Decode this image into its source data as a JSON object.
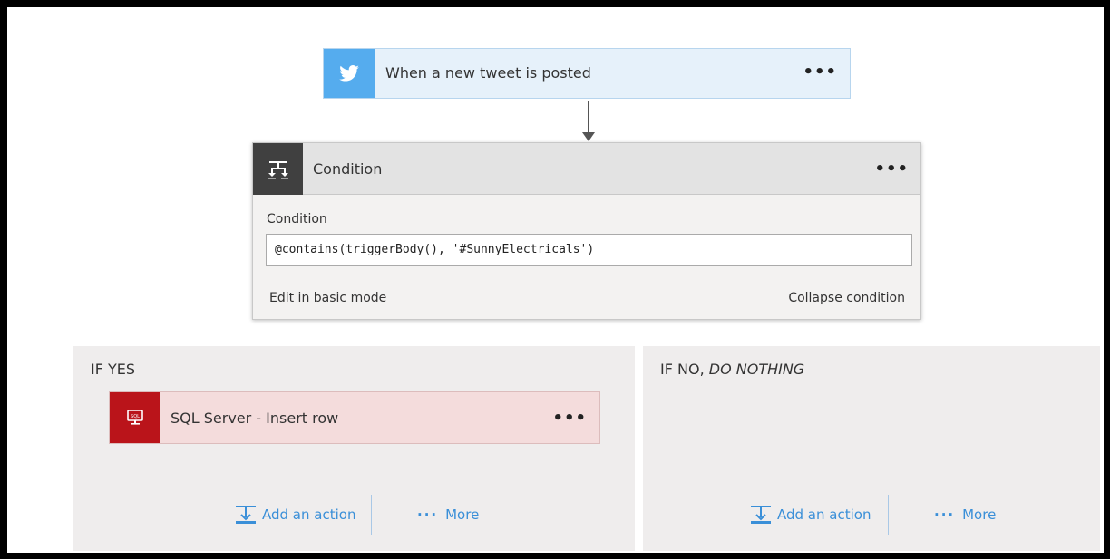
{
  "trigger": {
    "title": "When a new tweet is posted",
    "menu_label": "•••",
    "icon": "twitter-bird-icon",
    "accent": "#55acee"
  },
  "condition_card": {
    "title": "Condition",
    "menu_label": "•••",
    "icon": "condition-icon",
    "field_label": "Condition",
    "field_value": "@contains(triggerBody(), '#SunnyElectricals')",
    "edit_basic_label": "Edit in basic mode",
    "collapse_label": "Collapse condition"
  },
  "branch_yes": {
    "heading": "IF YES",
    "action_card": {
      "title": "SQL Server - Insert row",
      "menu_label": "•••",
      "icon": "sql-server-icon",
      "accent": "#ba141a"
    },
    "add_action_label": "Add an action",
    "more_label": "More"
  },
  "branch_no": {
    "heading_prefix": "IF NO, ",
    "heading_emphasis": "DO NOTHING",
    "add_action_label": "Add an action",
    "more_label": "More"
  },
  "colors": {
    "link_blue": "#3a8fd8",
    "branch_bg": "#efeded"
  }
}
